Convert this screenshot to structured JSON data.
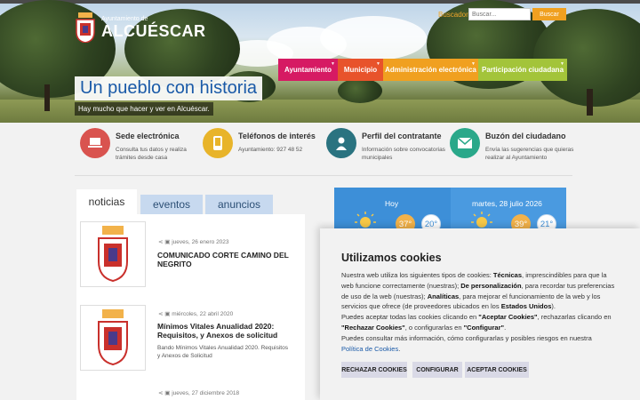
{
  "header": {
    "logo_small": "Ayuntamiento de",
    "logo_big": "ALCUÉSCAR",
    "search_link": "Buscador",
    "search_placeholder": "Buscar...",
    "search_button": "Buscar"
  },
  "nav": {
    "items": [
      {
        "label": "Ayuntamiento",
        "color": "#d61a63"
      },
      {
        "label": "Municipio",
        "color": "#e8532b"
      },
      {
        "label": "Administración electrónica",
        "color": "#f0a020"
      },
      {
        "label": "Participación ciudadana",
        "color": "#a3c43a"
      }
    ]
  },
  "hero": {
    "headline": "Un pueblo con historia",
    "subheadline": "Hay mucho que hacer y ver en Alcuéscar."
  },
  "quick_links": [
    {
      "title": "Sede electrónica",
      "desc": "Consulta tus datos y realiza trámites desde casa",
      "icon": "laptop-icon",
      "color": "#d9534f"
    },
    {
      "title": "Teléfonos de interés",
      "desc": "Ayuntamiento: 927 48 52",
      "icon": "phone-icon",
      "color": "#e8b42a"
    },
    {
      "title": "Perfil del contratante",
      "desc": "Información sobre convocatorias municipales",
      "icon": "person-icon",
      "color": "#2a7380"
    },
    {
      "title": "Buzón del ciudadano",
      "desc": "Envía las sugerencias que quieras realizar al Ayuntamiento",
      "icon": "mailbox-icon",
      "color": "#2aa88a"
    }
  ],
  "tabs": [
    {
      "label": "noticias"
    },
    {
      "label": "eventos"
    },
    {
      "label": "anuncios"
    }
  ],
  "news": [
    {
      "date": "jueves, 26 enero 2023",
      "title": "COMUNICADO CORTE CAMINO DEL NEGRITO",
      "summary": ""
    },
    {
      "date": "miércoles, 22 abril 2020",
      "title": "Mínimos Vitales Anualidad 2020: Requisitos, y Anexos de solicitud",
      "summary": "Bando Mínimos Vitales Anualidad 2020. Requisitos y Anexos de Solicitud"
    },
    {
      "date": "jueves, 27 diciembre 2018",
      "title": "",
      "summary": ""
    }
  ],
  "weather": {
    "today_label": "Hoy",
    "today_max": "37°",
    "today_min": "20°",
    "next_label": "martes, 28 julio 2026",
    "next_max": "39°",
    "next_min": "21°"
  },
  "cookies": {
    "title": "Utilizamos cookies",
    "p1_a": "Nuestra web utiliza los siguientes tipos de cookies: ",
    "p1_b": "Técnicas",
    "p1_c": ", imprescindibles para que la web funcione correctamente (nuestras); ",
    "p1_d": "De personalización",
    "p1_e": ", para recordar tus preferencias de uso de la web (nuestras); ",
    "p1_f": "Analíticas",
    "p1_g": ", para mejorar el funcionamiento de la web y los servicios que ofrece (de proveedores ubicados en los ",
    "p1_h": "Estados Unidos",
    "p1_i": ").",
    "p2_a": "Puedes aceptar todas las cookies clicando en ",
    "p2_b": "\"Aceptar Cookies\"",
    "p2_c": ", rechazarlas clicando en ",
    "p2_d": "\"Rechazar Cookies\"",
    "p2_e": ", o configurarlas en ",
    "p2_f": "\"Configurar\"",
    "p2_g": ".",
    "p3": "Puedes consultar más información, cómo configurarlas y posibles riesgos en nuestra",
    "policy_link": "Política de Cookies",
    "p3_end": ".",
    "reject": "RECHAZAR COOKIES",
    "configure": "CONFIGURAR",
    "accept": "ACEPTAR COOKIES"
  }
}
